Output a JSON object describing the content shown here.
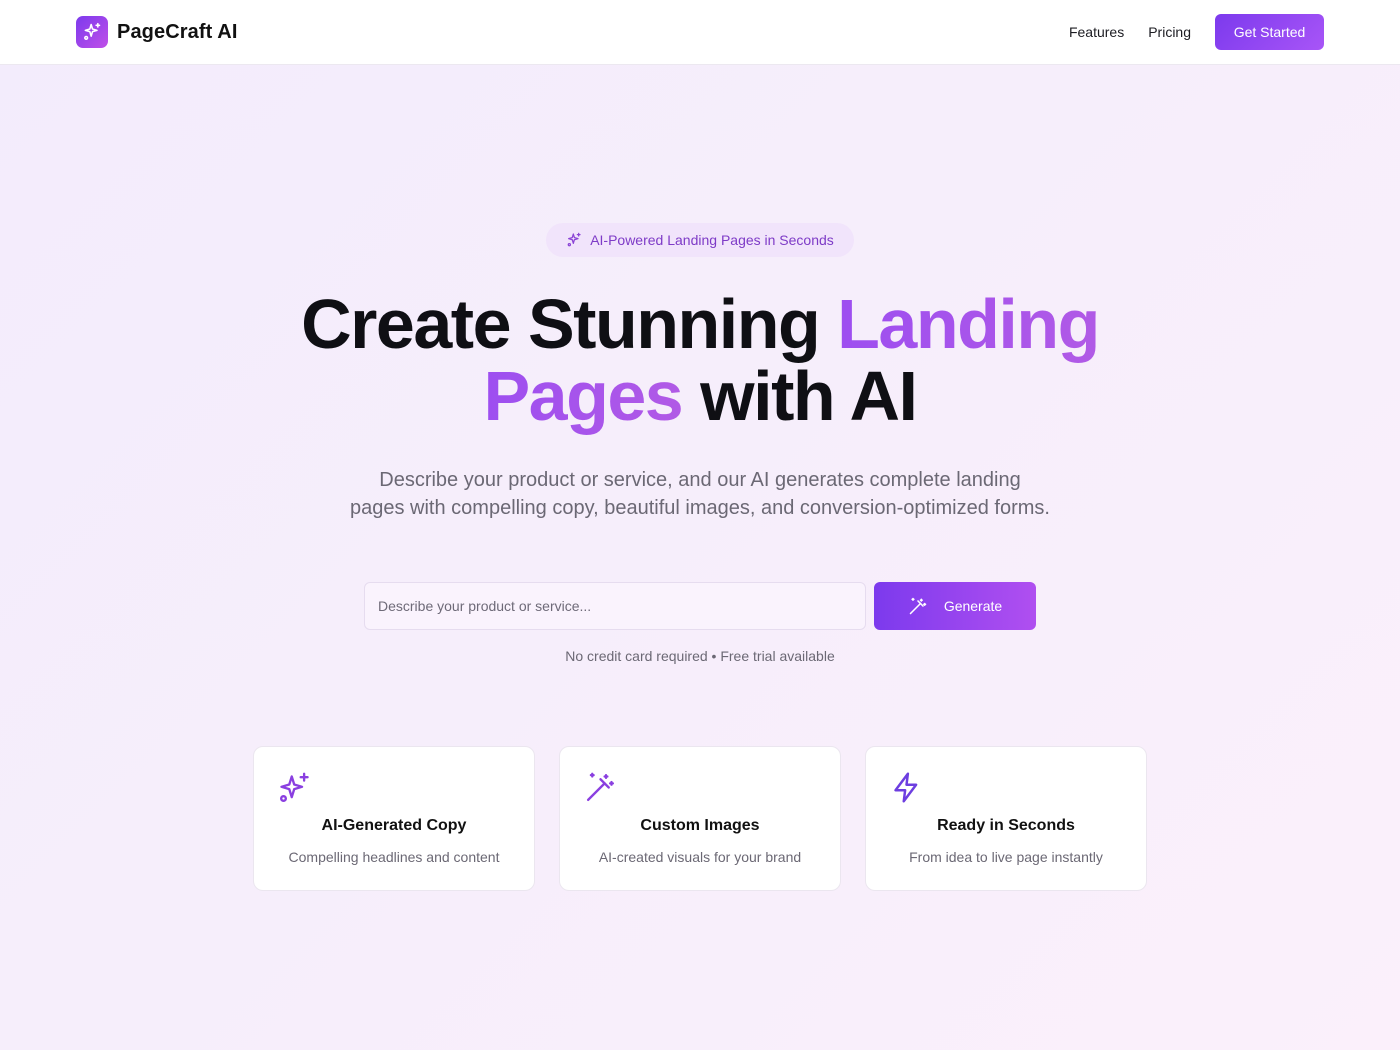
{
  "nav": {
    "brand": "PageCraft AI",
    "brand_icon": "sparkles-icon",
    "links": [
      "Features",
      "Pricing"
    ],
    "cta": "Get Started"
  },
  "hero": {
    "badge": "AI-Powered Landing Pages in Seconds",
    "badge_icon": "sparkles-icon",
    "title_part1": "Create Stunning ",
    "title_accent1": "Landing",
    "title_accent2": "Pages",
    "title_part2": " with AI",
    "subtitle": "Describe your product or service, and our AI generates complete landing pages with compelling copy, beautiful images, and conversion-optimized forms.",
    "input_value": "",
    "input_placeholder": "Describe your product or service...",
    "generate_label": "Generate",
    "generate_icon": "magic-wand-icon",
    "note": "No credit card required • Free trial available"
  },
  "features": [
    {
      "icon": "sparkles-icon",
      "title": "AI-Generated Copy",
      "desc": "Compelling headlines and content"
    },
    {
      "icon": "magic-wand-icon",
      "title": "Custom Images",
      "desc": "AI-created visuals for your brand"
    },
    {
      "icon": "lightning-icon",
      "title": "Ready in Seconds",
      "desc": "From idea to live page instantly"
    }
  ],
  "colors": {
    "accent": "#7c3aed",
    "accent_light": "#a855f7",
    "badge_bg": "#f1e4fb",
    "badge_text": "#7e3bc7",
    "muted_text": "#6b6874"
  }
}
